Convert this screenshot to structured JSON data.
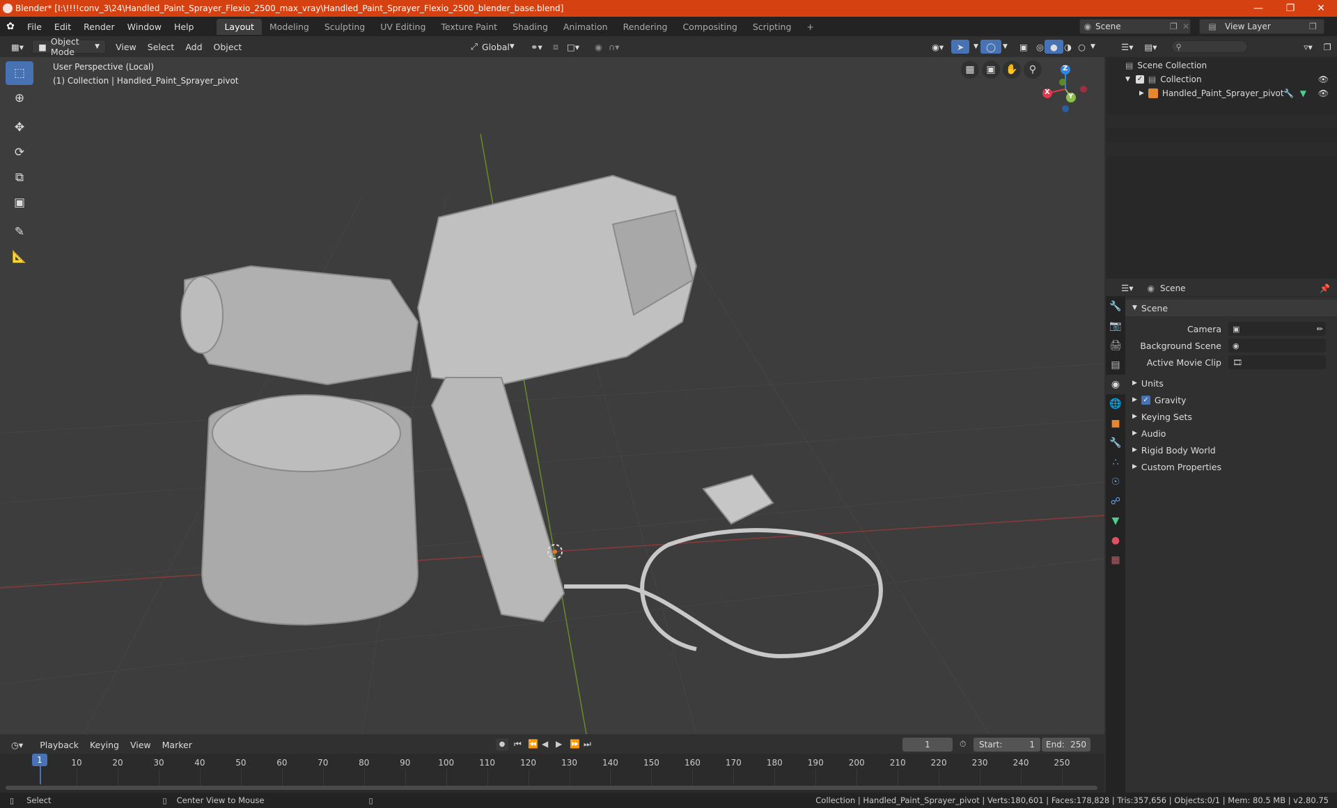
{
  "titlebar": {
    "title": "Blender* [I:\\!!!!conv_3\\24\\Handled_Paint_Sprayer_Flexio_2500_max_vray\\Handled_Paint_Sprayer_Flexio_2500_blender_base.blend]",
    "color": "#d64111"
  },
  "menu": {
    "items": [
      "File",
      "Edit",
      "Render",
      "Window",
      "Help"
    ]
  },
  "workspaces": {
    "active": "Layout",
    "tabs": [
      "Layout",
      "Modeling",
      "Sculpting",
      "UV Editing",
      "Texture Paint",
      "Shading",
      "Animation",
      "Rendering",
      "Compositing",
      "Scripting"
    ],
    "add": "+"
  },
  "scene_selector": {
    "value": "Scene"
  },
  "view_layer": {
    "value": "View Layer"
  },
  "viewport_header": {
    "mode": "Object Mode",
    "menus": [
      "View",
      "Select",
      "Add",
      "Object"
    ],
    "orientation": "Global"
  },
  "viewport": {
    "info_line1": "User Perspective (Local)",
    "info_line2": "(1) Collection | Handled_Paint_Sprayer_pivot",
    "gizmo": {
      "x": "X",
      "y": "Y",
      "z": "Z"
    }
  },
  "outliner": {
    "root": "Scene Collection",
    "collection": "Collection",
    "object": "Handled_Paint_Sprayer_pivot"
  },
  "properties": {
    "context": "Scene",
    "panel_title": "Scene",
    "fields": [
      {
        "label": "Camera",
        "value": ""
      },
      {
        "label": "Background Scene",
        "value": ""
      },
      {
        "label": "Active Movie Clip",
        "value": ""
      }
    ],
    "sections": [
      "Units",
      "Gravity",
      "Keying Sets",
      "Audio",
      "Rigid Body World",
      "Custom Properties"
    ],
    "gravity_checked": true
  },
  "timeline": {
    "menus": [
      "Playback",
      "Keying",
      "View",
      "Marker"
    ],
    "current_frame": "1",
    "start_label": "Start:",
    "start": "1",
    "end_label": "End:",
    "end": "250",
    "ticks": [
      "1",
      "10",
      "20",
      "30",
      "40",
      "50",
      "60",
      "70",
      "80",
      "90",
      "100",
      "110",
      "120",
      "130",
      "140",
      "150",
      "160",
      "170",
      "180",
      "190",
      "200",
      "210",
      "220",
      "230",
      "240",
      "250"
    ]
  },
  "statusbar": {
    "left": "Select",
    "middle": "Center View to Mouse",
    "right": "Collection | Handled_Paint_Sprayer_pivot | Verts:180,601 | Faces:178,828 | Tris:357,656 | Objects:0/1 | Mem: 80.5 MB | v2.80.75"
  },
  "colors": {
    "accent": "#4772b3",
    "axis_x": "#e2374c",
    "axis_y": "#8bc34a",
    "axis_z": "#2f85e2",
    "model": "#b4b4b4"
  }
}
